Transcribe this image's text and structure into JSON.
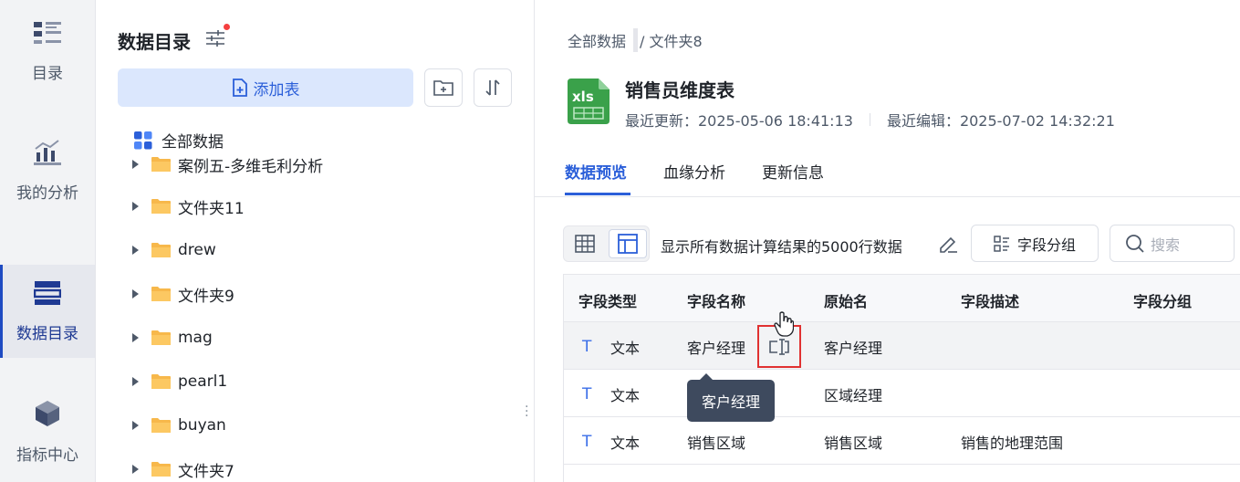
{
  "nav": {
    "items": [
      {
        "label": "目录",
        "icon": "list-icon"
      },
      {
        "label": "我的分析",
        "icon": "bar-chart-icon"
      },
      {
        "label": "数据目录",
        "icon": "database-icon",
        "active": true
      },
      {
        "label": "指标中心",
        "icon": "cube-icon"
      }
    ]
  },
  "catalog": {
    "title": "数据目录",
    "add_table_label": "添加表",
    "all_data_label": "全部数据",
    "tree": [
      {
        "label": "案例五-多维毛利分析"
      },
      {
        "label": "文件夹11"
      },
      {
        "label": "drew"
      },
      {
        "label": "文件夹9"
      },
      {
        "label": "mag"
      },
      {
        "label": "pearl1"
      },
      {
        "label": "buyan"
      },
      {
        "label": "文件夹7"
      }
    ]
  },
  "main": {
    "breadcrumb": {
      "root": "全部数据",
      "current": "/ 文件夹8"
    },
    "table_name": "销售员维度表",
    "last_update": "最近更新：2025-05-06 18:41:13",
    "last_edit": "最近编辑：2025-07-02 14:32:21",
    "tabs": [
      {
        "label": "数据预览",
        "active": true
      },
      {
        "label": "血缘分析"
      },
      {
        "label": "更新信息"
      }
    ],
    "show_text": "显示所有数据计算结果的5000行数据",
    "group_button_label": "字段分组",
    "search_placeholder": "搜索",
    "columns": [
      "字段类型",
      "字段名称",
      "原始名",
      "字段描述",
      "字段分组"
    ],
    "rows": [
      {
        "type": "文本",
        "name": "客户经理",
        "original": "客户经理",
        "desc": "",
        "group": ""
      },
      {
        "type": "文本",
        "name": "",
        "original": "区域经理",
        "desc": "",
        "group": ""
      },
      {
        "type": "文本",
        "name": "销售区域",
        "original": "销售区域",
        "desc": "销售的地理范围",
        "group": ""
      }
    ],
    "tooltip": "客户经理"
  },
  "colors": {
    "accent": "#2b5fd9",
    "highlight_box": "#e03131",
    "tooltip_bg": "#3e4a5e"
  }
}
